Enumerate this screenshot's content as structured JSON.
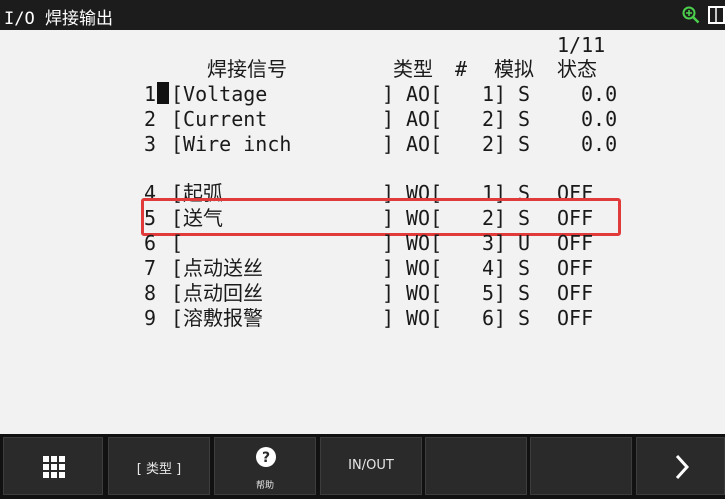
{
  "window": {
    "title": "I/O 焊接输出"
  },
  "header": {
    "page": "1/11",
    "col_signal": "焊接信号",
    "col_type": "类型",
    "col_hash": "#",
    "col_sim": "模拟",
    "col_status": "状态"
  },
  "rows": [
    {
      "num": "1",
      "name": "[Voltage",
      "rb": "]",
      "type": "AO[",
      "idx": "1]",
      "sim": "S",
      "status": "0.0"
    },
    {
      "num": "2",
      "name": "[Current",
      "rb": "]",
      "type": "AO[",
      "idx": "2]",
      "sim": "S",
      "status": "0.0"
    },
    {
      "num": "3",
      "name": "[Wire inch",
      "rb": "]",
      "type": "AO[",
      "idx": "2]",
      "sim": "S",
      "status": "0.0"
    },
    {
      "num": "4",
      "name": "[起弧",
      "rb": "]",
      "type": "WO[",
      "idx": "1]",
      "sim": "S",
      "status": "OFF"
    },
    {
      "num": "5",
      "name": "[送气",
      "rb": "]",
      "type": "WO[",
      "idx": "2]",
      "sim": "S",
      "status": "OFF"
    },
    {
      "num": "6",
      "name": "[",
      "rb": "]",
      "type": "WO[",
      "idx": "3]",
      "sim": "U",
      "status": "OFF"
    },
    {
      "num": "7",
      "name": "[点动送丝",
      "rb": "]",
      "type": "WO[",
      "idx": "4]",
      "sim": "S",
      "status": "OFF"
    },
    {
      "num": "8",
      "name": "[点动回丝",
      "rb": "]",
      "type": "WO[",
      "idx": "5]",
      "sim": "S",
      "status": "OFF"
    },
    {
      "num": "9",
      "name": "[溶敷报警",
      "rb": "]",
      "type": "WO[",
      "idx": "6]",
      "sim": "S",
      "status": "OFF"
    }
  ],
  "softkeys": {
    "type_label": "[ 类型 ]",
    "help_label": "帮助",
    "inout_label": "IN/OUT"
  },
  "icons": {
    "menu": "grid-icon",
    "help": "help-icon",
    "next": "chevron-right-icon",
    "zoom": "zoom-icon",
    "maximize": "maximize-icon"
  },
  "colors": {
    "highlight": "#e03a3a",
    "titlebar": "#1c1c1c",
    "screen": "#f2f2f2"
  }
}
